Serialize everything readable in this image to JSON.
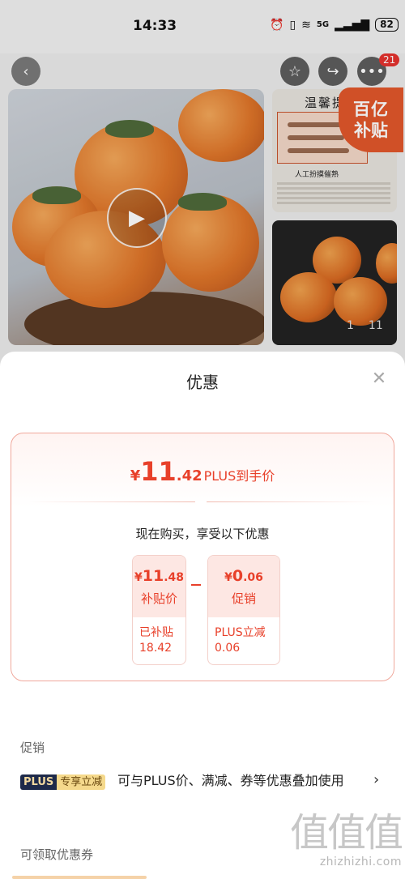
{
  "status_bar": {
    "time": "14:33",
    "network": "5G",
    "battery": "82"
  },
  "product_page": {
    "more_badge": "21",
    "image_tip_title": "温馨提",
    "image_tip_subtitle": "人工扮摸催熟",
    "subsidy_badge_line1": "百亿",
    "subsidy_badge_line2": "补贴",
    "image_counter_current": "1",
    "image_counter_total": "11",
    "icons": {
      "back": "chevron-left-icon",
      "favorite": "star-icon",
      "share": "share-icon",
      "more": "more-icon",
      "play": "play-icon"
    }
  },
  "sheet": {
    "title": "优惠",
    "close_icon": "close-icon",
    "plus_price": {
      "yen": "¥",
      "integer": "11",
      "decimal": ".42",
      "label": "PLUS到手价"
    },
    "enjoy_text": "现在购买，享受以下优惠",
    "subsidy_box": {
      "yen": "¥",
      "integer": "11",
      "decimal": ".48",
      "label": "补贴价",
      "detail_line1": "已补贴",
      "detail_line2": "18.42"
    },
    "promo_box": {
      "yen": "¥",
      "integer": "0",
      "decimal": ".06",
      "label": "促销",
      "detail_line1": "PLUS立减",
      "detail_line2": "0.06"
    },
    "promo_section_title": "促销",
    "promo_row": {
      "tag_plus": "PLUS",
      "tag_text": "专享立减",
      "description": "可与PLUS价、满减、券等优惠叠加使用",
      "chevron": "›"
    },
    "coupon_section_title": "可领取优惠券"
  },
  "watermark": {
    "logo": "值值值",
    "url": "zhizhizhi.com"
  },
  "colors": {
    "accent_red": "#e8402a",
    "plus_navy": "#1e2a4a",
    "plus_gold": "#f5d98c",
    "subsidy_orange": "#e2572b"
  }
}
